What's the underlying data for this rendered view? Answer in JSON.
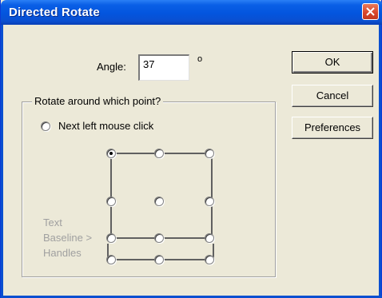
{
  "window": {
    "title": "Directed Rotate",
    "close_icon": "close-x-icon"
  },
  "angle": {
    "label": "Angle:",
    "value": "37",
    "unit": "o"
  },
  "buttons": {
    "ok": "OK",
    "cancel": "Cancel",
    "preferences": "Preferences"
  },
  "rotate_group": {
    "legend": "Rotate around which point?",
    "next_click_label": "Next left mouse click",
    "handles_note": [
      "Text",
      "Baseline >",
      "Handles"
    ],
    "selected_point": "top-left"
  },
  "colors": {
    "title_bar": "#0355de",
    "dialog_bg": "#ece9d8",
    "close_button": "#d8452a"
  }
}
